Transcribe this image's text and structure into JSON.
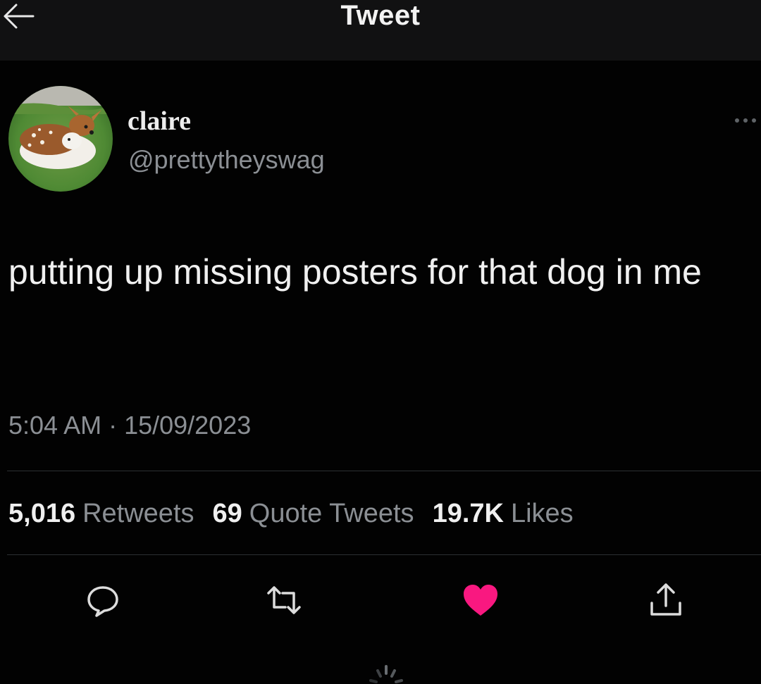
{
  "header": {
    "title": "Tweet",
    "back_icon": "arrow-left-icon"
  },
  "author": {
    "display_name": "claire",
    "handle": "@prettytheyswag",
    "avatar_icon": "fawn-avatar-image"
  },
  "tweet": {
    "text": "putting up missing posters for that dog in me",
    "timestamp": "5:04 AM · 15/09/2023"
  },
  "stats": {
    "retweets_count": "5,016",
    "retweets_label": "Retweets",
    "quotes_count": "69",
    "quotes_label": "Quote Tweets",
    "likes_count": "19.7K",
    "likes_label": "Likes"
  },
  "actions": {
    "reply_icon": "reply-icon",
    "retweet_icon": "retweet-icon",
    "like_icon": "heart-icon",
    "share_icon": "share-icon"
  },
  "colors": {
    "background": "#020202",
    "header_background": "#111112",
    "primary_text": "#f0f0f0",
    "secondary_text": "#8b8f94",
    "like_active": "#f91880",
    "divider": "#2c2f32"
  }
}
